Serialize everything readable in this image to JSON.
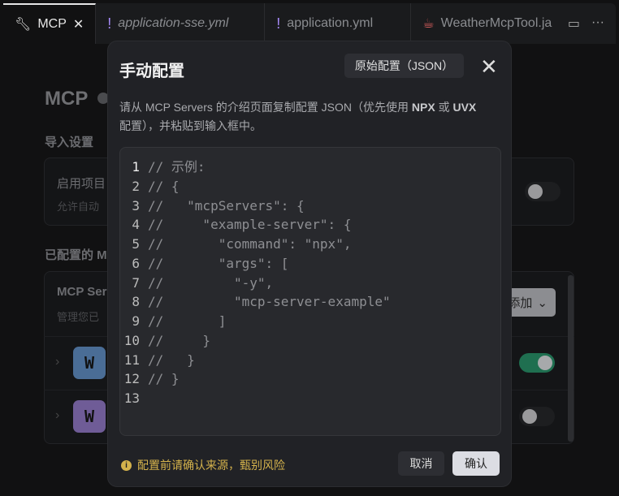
{
  "tabs": [
    {
      "label": "MCP",
      "active": true
    },
    {
      "label": "application-sse.yml",
      "italic": true
    },
    {
      "label": "application.yml"
    },
    {
      "label": "WeatherMcpTool.ja"
    }
  ],
  "page": {
    "title": "MCP",
    "import_heading": "导入设置",
    "import_item_title": "启用项目",
    "import_item_desc": "允许自动",
    "configured_heading": "已配置的 M",
    "servers_title": "MCP Ser",
    "servers_desc": "管理您已",
    "add_label": "添加",
    "servers": [
      {
        "avatar": "W",
        "color": "#4a6d96",
        "enabled": true
      },
      {
        "avatar": "W",
        "color": "#6f5c97",
        "enabled": false
      }
    ]
  },
  "modal": {
    "title": "手动配置",
    "raw_button": "原始配置（JSON）",
    "description_parts": [
      "请从 MCP Servers 的介绍页面复制配置 JSON（优先使用 ",
      "NPX",
      " 或 ",
      "UVX",
      "配置），并粘贴到输入框中。"
    ],
    "code_lines": [
      "// 示例:",
      "// {",
      "//   \"mcpServers\": {",
      "//     \"example-server\": {",
      "//       \"command\": \"npx\",",
      "//       \"args\": [",
      "//         \"-y\",",
      "//         \"mcp-server-example\"",
      "//       ]",
      "//     }",
      "//   }",
      "// }",
      ""
    ],
    "warning": "配置前请确认来源，甄别风险",
    "cancel": "取消",
    "confirm": "确认"
  }
}
